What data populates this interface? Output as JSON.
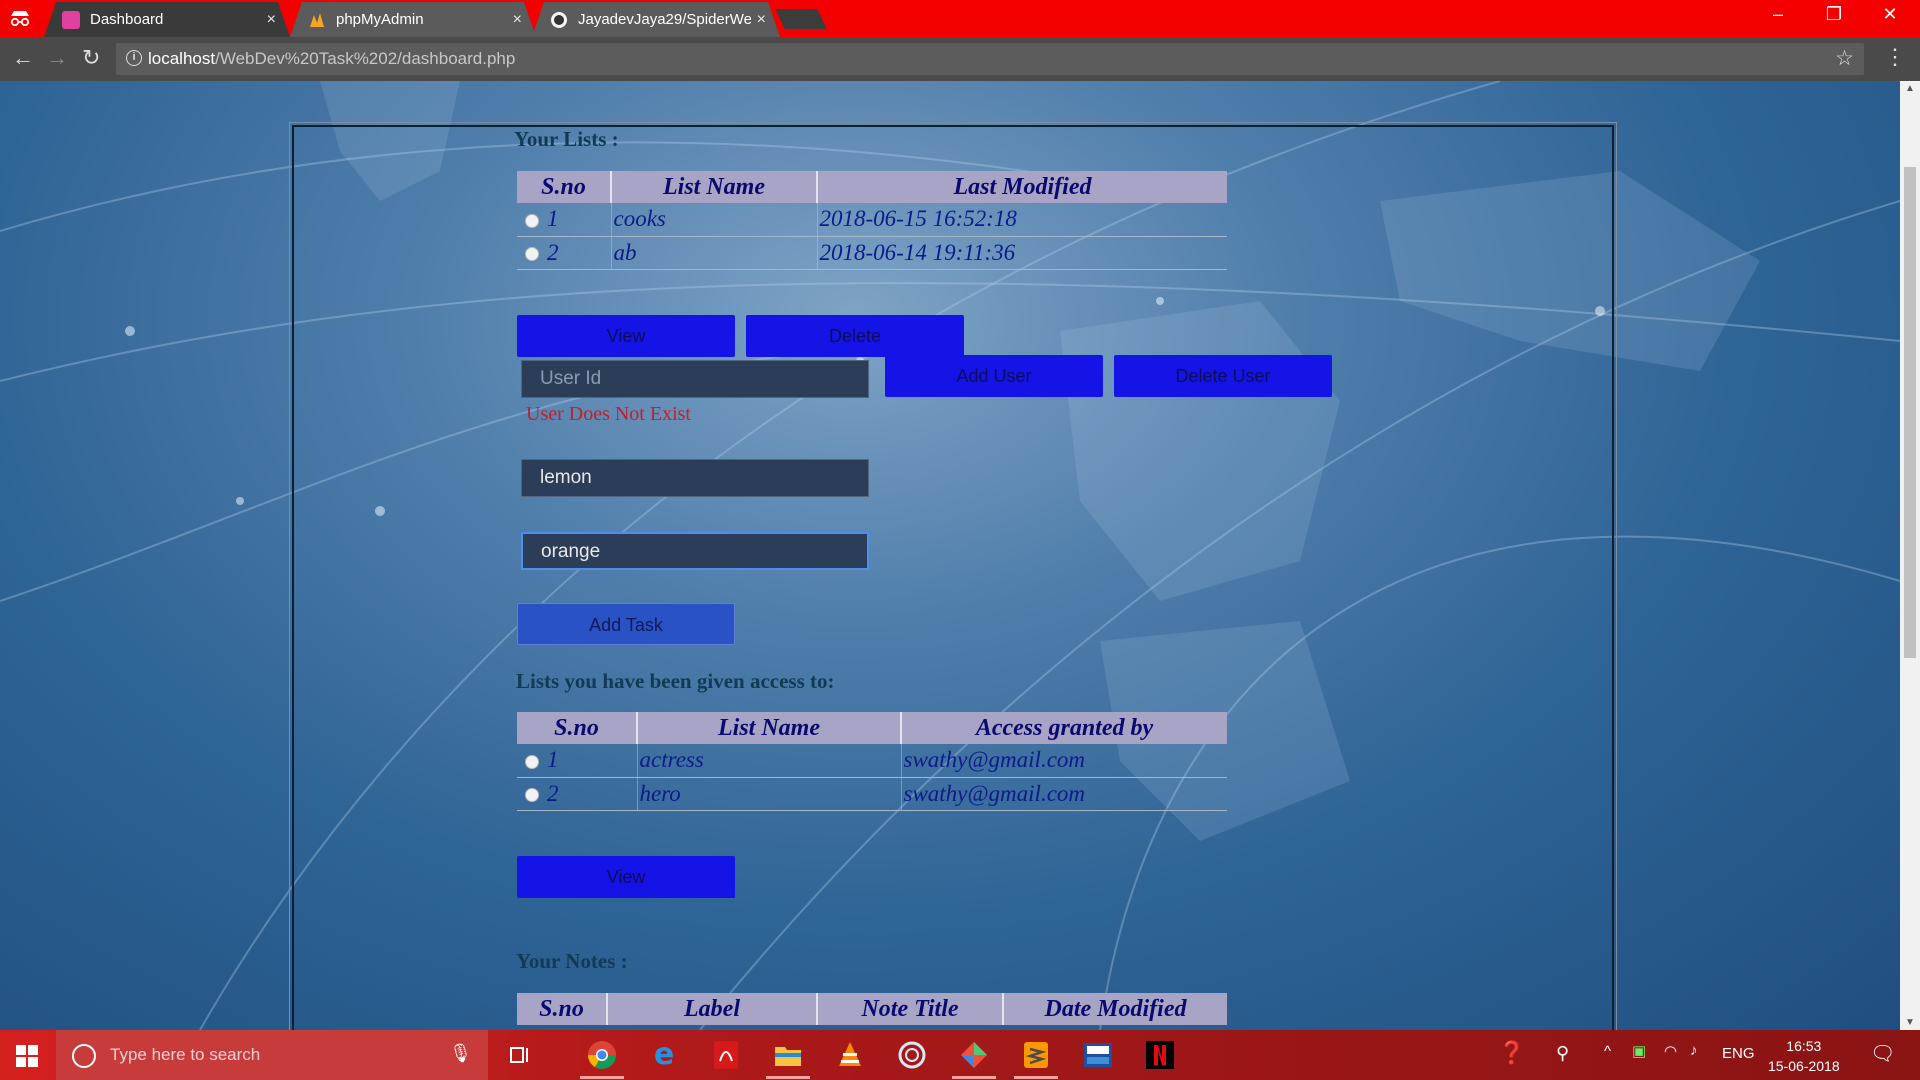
{
  "browser": {
    "tabs": [
      {
        "title": "Dashboard",
        "active": true,
        "favicon_color": "#e040a0"
      },
      {
        "title": "phpMyAdmin",
        "active": false,
        "favicon_color": "#f5a623"
      },
      {
        "title": "JayadevJaya29/SpiderWe",
        "active": false,
        "favicon_color": "#333333"
      }
    ],
    "tab_close": "×",
    "window": {
      "minimize": "–",
      "restore": "❐",
      "close": "✕"
    },
    "nav": {
      "back": "←",
      "forward": "→",
      "reload": "↻"
    },
    "address": {
      "host": "localhost",
      "path": "/WebDev%20Task%202/dashboard.php"
    },
    "star": "☆",
    "menu": "⋮"
  },
  "your_lists": {
    "heading": "Your Lists :",
    "columns": [
      "S.no",
      "List Name",
      "Last Modified"
    ],
    "rows": [
      {
        "sno": "1",
        "name": "cooks",
        "modified": "2018-06-15 16:52:18"
      },
      {
        "sno": "2",
        "name": "ab",
        "modified": "2018-06-14 19:11:36"
      }
    ],
    "view_button": "View",
    "delete_button": "Delete"
  },
  "user_access": {
    "user_id_placeholder": "User Id",
    "add_user_button": "Add User",
    "delete_user_button": "Delete User",
    "error": "User Does Not Exist"
  },
  "tasks": {
    "task_fields": [
      "lemon",
      "orange"
    ],
    "add_task_button": "Add Task"
  },
  "shared_lists": {
    "heading": "Lists you have been given access to:",
    "columns": [
      "S.no",
      "List Name",
      "Access granted by"
    ],
    "rows": [
      {
        "sno": "1",
        "name": "actress",
        "granted_by": "swathy@gmail.com"
      },
      {
        "sno": "2",
        "name": "hero",
        "granted_by": "swathy@gmail.com"
      }
    ],
    "view_button": "View"
  },
  "notes": {
    "heading": "Your Notes :",
    "columns": [
      "S.no",
      "Label",
      "Note Title",
      "Date Modified"
    ]
  },
  "taskbar": {
    "search_placeholder": "Type here to search",
    "apps": [
      "task-view",
      "chrome",
      "edge",
      "acrobat",
      "file-explorer",
      "vlc",
      "browser",
      "git",
      "sublime",
      "devcpp",
      "netflix"
    ],
    "language": "ENG",
    "time": "16:53",
    "date": "15-06-2018"
  },
  "colors": {
    "tabbar": "#f40000",
    "button_blue": "#1414e6",
    "table_header": "#a7a4c6",
    "table_text": "#0c1b8a",
    "error_red": "#c0202a",
    "heading": "#123a52"
  }
}
